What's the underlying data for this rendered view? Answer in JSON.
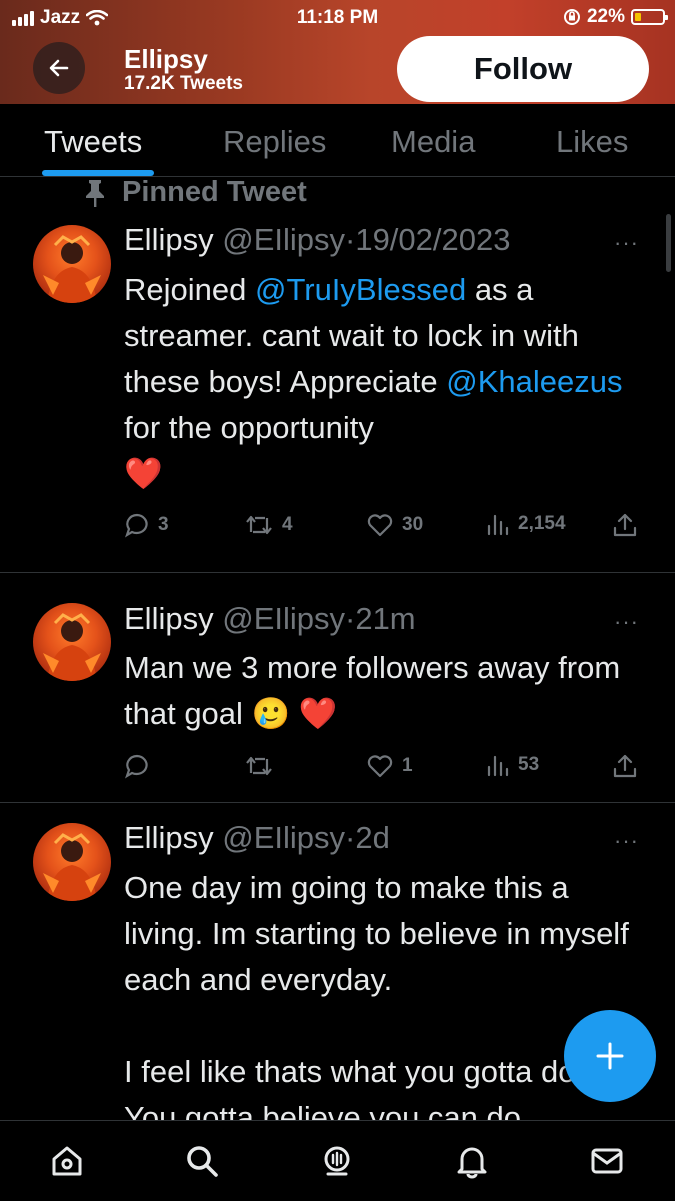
{
  "status_bar": {
    "carrier": "Jazz",
    "time": "11:18 PM",
    "battery_percent": "22%",
    "battery_level": 0.22,
    "battery_color": "#f5c400"
  },
  "header": {
    "back_icon": "arrow-left-icon",
    "name": "Ellipsy",
    "tweet_count": "17.2K Tweets",
    "follow_label": "Follow"
  },
  "tabs": [
    {
      "label": "Tweets",
      "active": true
    },
    {
      "label": "Replies",
      "active": false
    },
    {
      "label": "Media",
      "active": false
    },
    {
      "label": "Likes",
      "active": false
    }
  ],
  "pinned_label": "Pinned Tweet",
  "tweets": [
    {
      "name": "Ellipsy",
      "handle": "@EIlipsy",
      "sep": "·",
      "time": "19/02/2023",
      "text": {
        "t1": "Rejoined ",
        "m1": "@TruIyBlessed",
        "t2": " as a streamer. cant wait to lock in with these boys! Appreciate ",
        "m2": "@Khaleezus",
        "t3": " for the opportunity",
        "emoji": "❤️"
      },
      "replies": "3",
      "retweets": "4",
      "likes": "30",
      "views": "2,154"
    },
    {
      "name": "Ellipsy",
      "handle": "@EIlipsy",
      "sep": "·",
      "time": "21m",
      "text": {
        "t1": "Man we 3 more followers away from that goal ",
        "emoji": "🥲 ❤️"
      },
      "replies": "",
      "retweets": "",
      "likes": "1",
      "views": "53"
    },
    {
      "name": "Ellipsy",
      "handle": "@EIlipsy",
      "sep": "·",
      "time": "2d",
      "text": {
        "p1": "One day im going to make this a living. Im starting to believe in myself each and everyday.",
        "p2": "I feel like thats what you gotta do first. You gotta believe you can do"
      }
    }
  ],
  "more_icon_text": "···",
  "accent": "#1d9bf0",
  "bottom_nav": [
    "home-icon",
    "search-icon",
    "spaces-icon",
    "notifications-icon",
    "messages-icon"
  ]
}
